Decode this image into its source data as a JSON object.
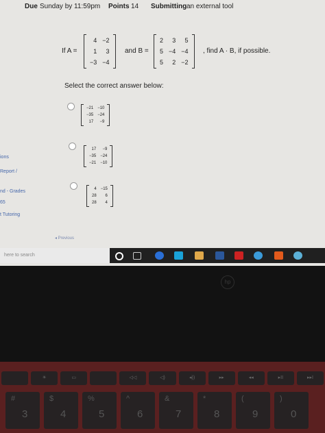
{
  "header": {
    "due_label": "Due",
    "due_value": "Sunday by 11:59pm",
    "points_label": "Points",
    "points_value": "14",
    "submitting_label": "Submitting",
    "submitting_value": "an external tool"
  },
  "sidebar": [
    "ions",
    "Report /",
    "nd - Grades",
    "65",
    "t Tutoring"
  ],
  "question": {
    "if_a": "If A =",
    "and_b": "and B =",
    "find": ", find A · B, if possible.",
    "matrix_a": [
      [
        "4",
        "−2"
      ],
      [
        "1",
        "3"
      ],
      [
        "−3",
        "−4"
      ]
    ],
    "matrix_b": [
      [
        "2",
        "3",
        "5"
      ],
      [
        "5",
        "−4",
        "−4"
      ],
      [
        "5",
        "2",
        "−2"
      ]
    ],
    "instruction": "Select the correct answer below:"
  },
  "options": [
    [
      [
        "−21",
        "−10"
      ],
      [
        "−35",
        "−24"
      ],
      [
        "17",
        "−9"
      ]
    ],
    [
      [
        "17",
        "−9"
      ],
      [
        "−35",
        "−24"
      ],
      [
        "−21",
        "−10"
      ]
    ],
    [
      [
        "4",
        "−15"
      ],
      [
        "28",
        "6"
      ],
      [
        "28",
        "4"
      ]
    ]
  ],
  "previous": "◂ Previous",
  "taskbar": {
    "search_placeholder": "here to search",
    "colors": [
      "#2a6fd6",
      "#1aa3d9",
      "#e0a84a",
      "#2b579a",
      "#cc2222",
      "#3b9bd9",
      "#e25a1c",
      "#5cb0d6"
    ]
  },
  "bezel": {
    "logo": "hp"
  },
  "keyboard": {
    "fkeys": [
      "",
      "☀",
      "▭",
      "",
      "◁◁",
      "◁)",
      "◂))",
      "▸▸",
      "◂◂",
      "▸II",
      "▸▸I"
    ],
    "numbers": [
      "3",
      "4",
      "5",
      "6",
      "7",
      "8",
      "9",
      "0"
    ],
    "symbols": [
      "#",
      "$",
      "%",
      "^",
      "&",
      "*",
      "(",
      ")"
    ]
  }
}
